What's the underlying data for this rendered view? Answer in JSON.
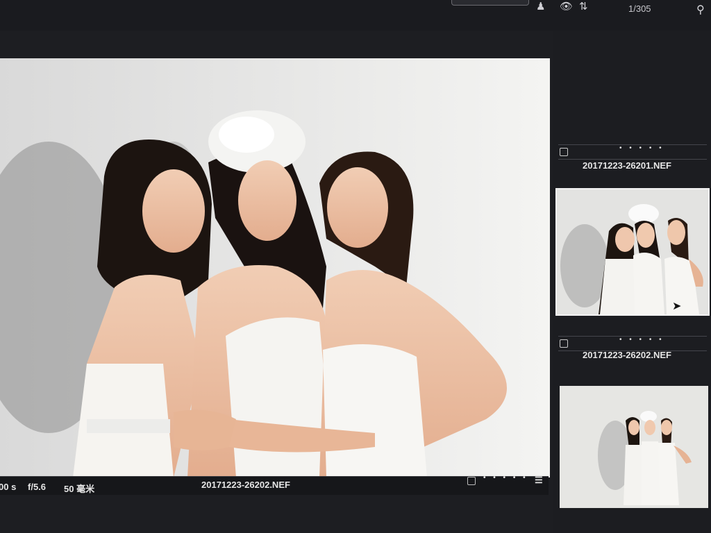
{
  "toolbar": {
    "counter": "1/305",
    "icons": [
      "person-icon",
      "eye-icon",
      "sort-icon",
      "search-icon"
    ]
  },
  "viewer": {
    "image_alt": "three women in white strapless dresses posing against a white wall"
  },
  "info_bar": {
    "shutter": "00 s",
    "aperture": "f/5.6",
    "focal_length": "50 毫米",
    "filename": "20171223-26202.NEF",
    "dots": "• • • • •"
  },
  "filmstrip": {
    "items": [
      {
        "name": "20171223-26201.NEF",
        "dots": "• • • • •",
        "selected": true
      },
      {
        "name": "20171223-26202.NEF",
        "dots": "• • • • •",
        "selected": false
      }
    ]
  },
  "colors": {
    "background": "#1d1e22",
    "wall": "#ececec",
    "selection_border": "#f2f2f2"
  }
}
